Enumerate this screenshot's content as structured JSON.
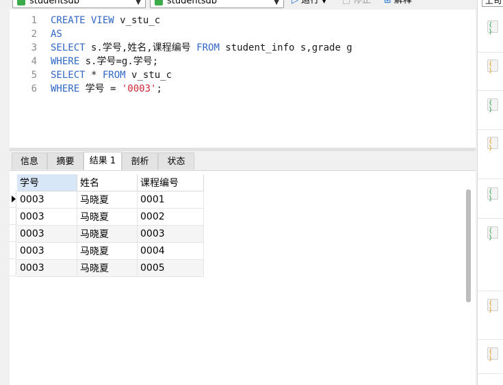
{
  "toolbar": {
    "connection": "studentsdb",
    "database": "studentsdb",
    "run_label": "运行",
    "stop_label": "停止",
    "explain_label": "解释"
  },
  "editor": {
    "line_numbers": [
      "1",
      "2",
      "3",
      "4",
      "5",
      "6"
    ],
    "lines": [
      [
        {
          "t": "CREATE VIEW",
          "c": "kw"
        },
        {
          "t": " v_stu_c",
          "c": ""
        }
      ],
      [
        {
          "t": "AS",
          "c": "kw"
        }
      ],
      [
        {
          "t": "SELECT",
          "c": "kw"
        },
        {
          "t": " s.学号,姓名,课程编号 ",
          "c": ""
        },
        {
          "t": "FROM",
          "c": "kw"
        },
        {
          "t": " student_info s,grade g",
          "c": ""
        }
      ],
      [
        {
          "t": "WHERE",
          "c": "kw"
        },
        {
          "t": " s.学号=g.学号;",
          "c": ""
        }
      ],
      [
        {
          "t": "SELECT",
          "c": "kw"
        },
        {
          "t": " * ",
          "c": ""
        },
        {
          "t": "FROM",
          "c": "kw"
        },
        {
          "t": " v_stu_c",
          "c": ""
        }
      ],
      [
        {
          "t": "WHERE",
          "c": "kw"
        },
        {
          "t": " 学号 = ",
          "c": ""
        },
        {
          "t": "'0003'",
          "c": "str"
        },
        {
          "t": ";",
          "c": ""
        }
      ]
    ]
  },
  "tabs": [
    "信息",
    "摘要",
    "结果 1",
    "剖析",
    "状态"
  ],
  "results": {
    "columns": [
      "学号",
      "姓名",
      "课程编号"
    ],
    "rows": [
      [
        "0003",
        "马晓夏",
        "0001"
      ],
      [
        "0003",
        "马晓夏",
        "0002"
      ],
      [
        "0003",
        "马晓夏",
        "0003"
      ],
      [
        "0003",
        "马晓夏",
        "0004"
      ],
      [
        "0003",
        "马晓夏",
        "0005"
      ]
    ]
  },
  "right_panel": {
    "top_label": "上司",
    "item_icons": [
      "query-icon-green",
      "query-icon-yellow",
      "query-icon-green",
      "query-icon-yellow",
      "query-icon-green",
      "query-icon-green",
      "query-icon-yellow",
      "query-icon-yellow"
    ]
  }
}
